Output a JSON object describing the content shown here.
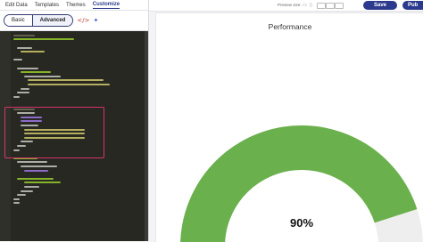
{
  "menu": {
    "items": [
      "Edit Data",
      "Templates",
      "Themes",
      "Customize"
    ],
    "active": "Customize"
  },
  "toolbar": {
    "basic_label": "Basic",
    "advanced_label": "Advanced",
    "code_icon": "code-icon",
    "theme_icon": "palette-icon"
  },
  "preview": {
    "size_label": "Preview size:",
    "devices": [
      "desktop-icon",
      "tablet-icon",
      "mobile-icon"
    ],
    "save_label": "Save",
    "publish_label": "Pub"
  },
  "chart_data": {
    "type": "gauge",
    "title": "Performance",
    "value": 90,
    "value_label": "90%",
    "min": 0,
    "max": 100,
    "band_color": "#6ab04c",
    "track_color": "#eeeeee"
  },
  "colors": {
    "accent": "#2b3a8c",
    "highlight": "#d6336c",
    "editor_bg": "#272822"
  }
}
